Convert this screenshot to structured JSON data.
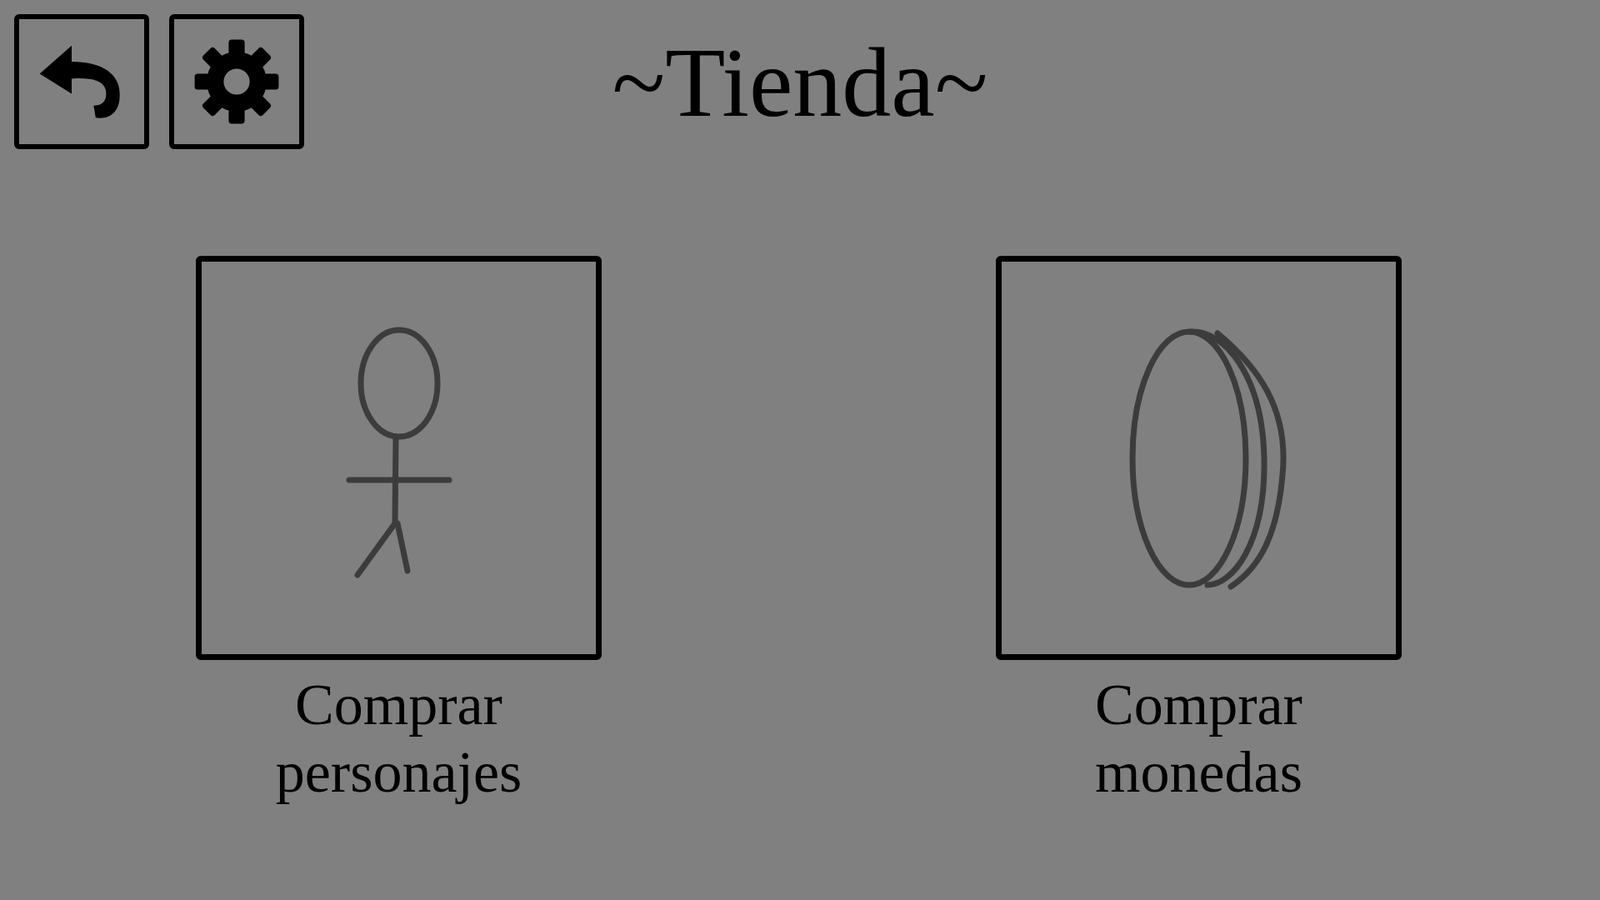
{
  "title": "~Tienda~",
  "options": [
    {
      "label": "Comprar personajes",
      "kind": "character"
    },
    {
      "label": "Comprar monedas",
      "kind": "coin"
    }
  ]
}
